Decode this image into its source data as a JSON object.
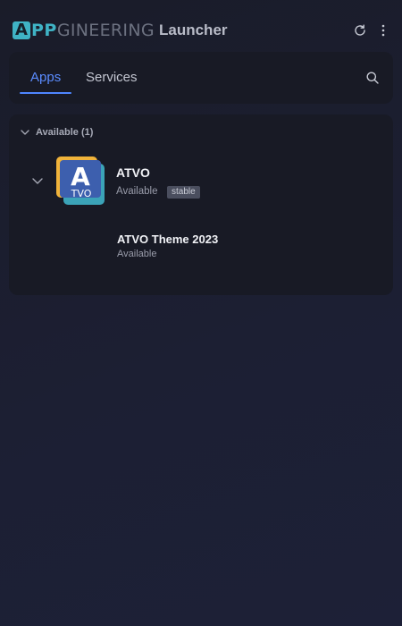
{
  "header": {
    "logo": {
      "first_letter": "A",
      "accent": "PP",
      "rest": "GINEERING"
    },
    "title": "Launcher",
    "refresh_icon": "refresh-icon",
    "menu_icon": "more-vertical-icon"
  },
  "tabs": [
    {
      "label": "Apps",
      "active": true
    },
    {
      "label": "Services",
      "active": false
    }
  ],
  "search_icon": "search-icon",
  "groups": [
    {
      "label": "Available (1)",
      "expanded": true,
      "items": [
        {
          "name": "ATVO",
          "status": "Available",
          "channel_badge": "stable",
          "icon": {
            "letter": "A",
            "subtitle": "TVO"
          },
          "expanded": true,
          "children": [
            {
              "name": "ATVO Theme 2023",
              "status": "Available"
            }
          ]
        }
      ]
    }
  ],
  "colors": {
    "accent": "#4f86ff",
    "logo_teal": "#3fb3c5",
    "icon_yellow": "#f0b33a",
    "icon_blue": "#3d5fae",
    "icon_teal": "#3ba3b8",
    "card_bg": "#181a25",
    "page_bg": "#1b1d2e"
  }
}
